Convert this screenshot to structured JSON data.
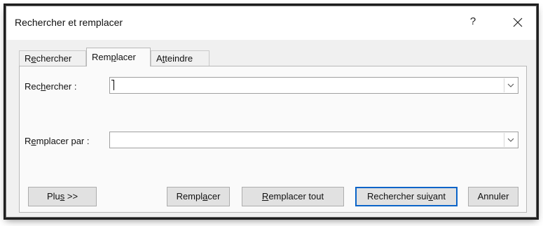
{
  "dialog": {
    "title": "Rechercher et remplacer",
    "help_label": "?",
    "close_icon": "close-icon"
  },
  "tabs": [
    {
      "pre": "R",
      "ul": "e",
      "post": "chercher",
      "label": "Rechercher",
      "active": false
    },
    {
      "pre": "Rem",
      "ul": "p",
      "post": "lacer",
      "label": "Remplacer",
      "active": true
    },
    {
      "pre": "A",
      "ul": "t",
      "post": "teindre",
      "label": "Atteindre",
      "active": false
    }
  ],
  "find": {
    "label_pre": "Rec",
    "label_ul": "h",
    "label_post": "ercher :",
    "label": "Rechercher :",
    "value": ""
  },
  "replace": {
    "label_pre": "R",
    "label_ul": "e",
    "label_post": "mplacer par :",
    "label": "Remplacer par :",
    "value": ""
  },
  "buttons": {
    "more": {
      "pre": "Plu",
      "ul": "s",
      "post": " >>",
      "label": "Plus >>"
    },
    "replace": {
      "pre": "Rempl",
      "ul": "a",
      "post": "cer",
      "label": "Remplacer"
    },
    "replace_all": {
      "pre": "",
      "ul": "R",
      "post": "emplacer tout",
      "label": "Remplacer tout"
    },
    "find_next": {
      "pre": "Rechercher sui",
      "ul": "v",
      "post": "ant",
      "label": "Rechercher suivant"
    },
    "cancel": {
      "pre": "Annuler",
      "ul": "",
      "post": "",
      "label": "Annuler"
    }
  },
  "colors": {
    "dialog_bg": "#f0f0f0",
    "panel_bg": "#fafafa",
    "default_button_border": "#0a64c8"
  }
}
